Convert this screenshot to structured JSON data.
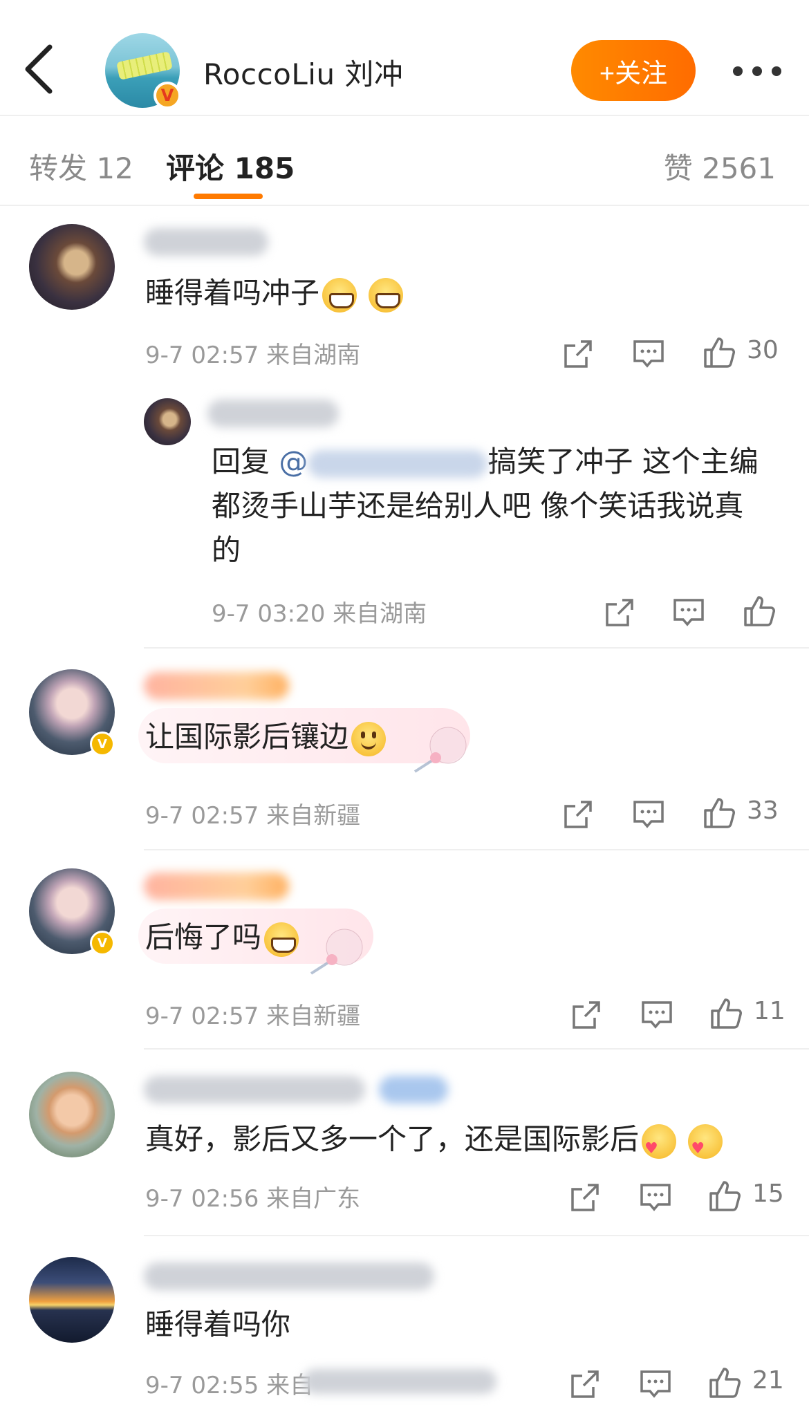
{
  "header": {
    "back_icon": "back-arrow-icon",
    "username": "RoccoLiu 刘冲",
    "follow_label": "+关注",
    "more_icon": "more-dots-icon",
    "verified_badge": "V"
  },
  "tabs": {
    "repost": "转发 12",
    "comments": "评论 185",
    "likes": "赞 2561"
  },
  "colors": {
    "accent": "#ff7a00",
    "follow_button": "#ff8a00",
    "mention": "#4a6fa5",
    "meta_text": "#9a9a9a"
  },
  "comments": [
    {
      "text": "睡得着吗冲子",
      "emojis": [
        "grin",
        "grin"
      ],
      "time": "9-7 02:57",
      "location": "来自湖南",
      "likes": "30",
      "reply": {
        "prefix": "回复",
        "mention": "@",
        "text_line1": "搞笑了冲子 这个主编",
        "text_line2": "都烫手山芋还是给别人吧 像个笑话我说真",
        "text_line3": "的",
        "time": "9-7 03:20",
        "location": "来自湖南"
      }
    },
    {
      "text": "让国际影后镶边",
      "emojis": [
        "smile"
      ],
      "time": "9-7 02:57",
      "location": "来自新疆",
      "likes": "33"
    },
    {
      "text": "后悔了吗",
      "emojis": [
        "grin"
      ],
      "time": "9-7 02:57",
      "location": "来自新疆",
      "likes": "11"
    },
    {
      "text": "真好，影后又多一个了，还是国际影后",
      "emojis": [
        "love",
        "love"
      ],
      "time": "9-7 02:56",
      "location": "来自广东",
      "likes": "15"
    },
    {
      "text": "睡得着吗你",
      "emojis": [],
      "time": "9-7 02:55",
      "location": "来自",
      "likes": "21"
    }
  ],
  "icons": {
    "share": "share-icon",
    "comment": "comment-icon",
    "like": "thumbs-up-icon"
  }
}
